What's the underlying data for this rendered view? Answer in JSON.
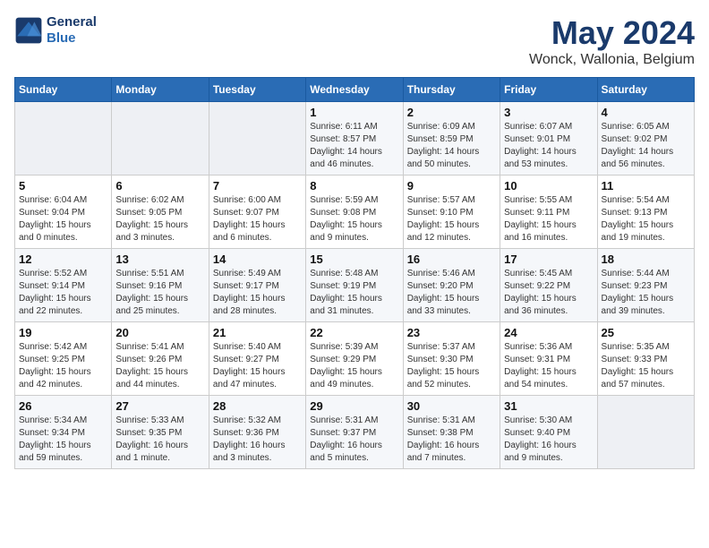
{
  "header": {
    "logo_line1": "General",
    "logo_line2": "Blue",
    "title": "May 2024",
    "subtitle": "Wonck, Wallonia, Belgium"
  },
  "days_of_week": [
    "Sunday",
    "Monday",
    "Tuesday",
    "Wednesday",
    "Thursday",
    "Friday",
    "Saturday"
  ],
  "weeks": [
    [
      {
        "num": "",
        "info": ""
      },
      {
        "num": "",
        "info": ""
      },
      {
        "num": "",
        "info": ""
      },
      {
        "num": "1",
        "info": "Sunrise: 6:11 AM\nSunset: 8:57 PM\nDaylight: 14 hours\nand 46 minutes."
      },
      {
        "num": "2",
        "info": "Sunrise: 6:09 AM\nSunset: 8:59 PM\nDaylight: 14 hours\nand 50 minutes."
      },
      {
        "num": "3",
        "info": "Sunrise: 6:07 AM\nSunset: 9:01 PM\nDaylight: 14 hours\nand 53 minutes."
      },
      {
        "num": "4",
        "info": "Sunrise: 6:05 AM\nSunset: 9:02 PM\nDaylight: 14 hours\nand 56 minutes."
      }
    ],
    [
      {
        "num": "5",
        "info": "Sunrise: 6:04 AM\nSunset: 9:04 PM\nDaylight: 15 hours\nand 0 minutes."
      },
      {
        "num": "6",
        "info": "Sunrise: 6:02 AM\nSunset: 9:05 PM\nDaylight: 15 hours\nand 3 minutes."
      },
      {
        "num": "7",
        "info": "Sunrise: 6:00 AM\nSunset: 9:07 PM\nDaylight: 15 hours\nand 6 minutes."
      },
      {
        "num": "8",
        "info": "Sunrise: 5:59 AM\nSunset: 9:08 PM\nDaylight: 15 hours\nand 9 minutes."
      },
      {
        "num": "9",
        "info": "Sunrise: 5:57 AM\nSunset: 9:10 PM\nDaylight: 15 hours\nand 12 minutes."
      },
      {
        "num": "10",
        "info": "Sunrise: 5:55 AM\nSunset: 9:11 PM\nDaylight: 15 hours\nand 16 minutes."
      },
      {
        "num": "11",
        "info": "Sunrise: 5:54 AM\nSunset: 9:13 PM\nDaylight: 15 hours\nand 19 minutes."
      }
    ],
    [
      {
        "num": "12",
        "info": "Sunrise: 5:52 AM\nSunset: 9:14 PM\nDaylight: 15 hours\nand 22 minutes."
      },
      {
        "num": "13",
        "info": "Sunrise: 5:51 AM\nSunset: 9:16 PM\nDaylight: 15 hours\nand 25 minutes."
      },
      {
        "num": "14",
        "info": "Sunrise: 5:49 AM\nSunset: 9:17 PM\nDaylight: 15 hours\nand 28 minutes."
      },
      {
        "num": "15",
        "info": "Sunrise: 5:48 AM\nSunset: 9:19 PM\nDaylight: 15 hours\nand 31 minutes."
      },
      {
        "num": "16",
        "info": "Sunrise: 5:46 AM\nSunset: 9:20 PM\nDaylight: 15 hours\nand 33 minutes."
      },
      {
        "num": "17",
        "info": "Sunrise: 5:45 AM\nSunset: 9:22 PM\nDaylight: 15 hours\nand 36 minutes."
      },
      {
        "num": "18",
        "info": "Sunrise: 5:44 AM\nSunset: 9:23 PM\nDaylight: 15 hours\nand 39 minutes."
      }
    ],
    [
      {
        "num": "19",
        "info": "Sunrise: 5:42 AM\nSunset: 9:25 PM\nDaylight: 15 hours\nand 42 minutes."
      },
      {
        "num": "20",
        "info": "Sunrise: 5:41 AM\nSunset: 9:26 PM\nDaylight: 15 hours\nand 44 minutes."
      },
      {
        "num": "21",
        "info": "Sunrise: 5:40 AM\nSunset: 9:27 PM\nDaylight: 15 hours\nand 47 minutes."
      },
      {
        "num": "22",
        "info": "Sunrise: 5:39 AM\nSunset: 9:29 PM\nDaylight: 15 hours\nand 49 minutes."
      },
      {
        "num": "23",
        "info": "Sunrise: 5:37 AM\nSunset: 9:30 PM\nDaylight: 15 hours\nand 52 minutes."
      },
      {
        "num": "24",
        "info": "Sunrise: 5:36 AM\nSunset: 9:31 PM\nDaylight: 15 hours\nand 54 minutes."
      },
      {
        "num": "25",
        "info": "Sunrise: 5:35 AM\nSunset: 9:33 PM\nDaylight: 15 hours\nand 57 minutes."
      }
    ],
    [
      {
        "num": "26",
        "info": "Sunrise: 5:34 AM\nSunset: 9:34 PM\nDaylight: 15 hours\nand 59 minutes."
      },
      {
        "num": "27",
        "info": "Sunrise: 5:33 AM\nSunset: 9:35 PM\nDaylight: 16 hours\nand 1 minute."
      },
      {
        "num": "28",
        "info": "Sunrise: 5:32 AM\nSunset: 9:36 PM\nDaylight: 16 hours\nand 3 minutes."
      },
      {
        "num": "29",
        "info": "Sunrise: 5:31 AM\nSunset: 9:37 PM\nDaylight: 16 hours\nand 5 minutes."
      },
      {
        "num": "30",
        "info": "Sunrise: 5:31 AM\nSunset: 9:38 PM\nDaylight: 16 hours\nand 7 minutes."
      },
      {
        "num": "31",
        "info": "Sunrise: 5:30 AM\nSunset: 9:40 PM\nDaylight: 16 hours\nand 9 minutes."
      },
      {
        "num": "",
        "info": ""
      }
    ]
  ]
}
